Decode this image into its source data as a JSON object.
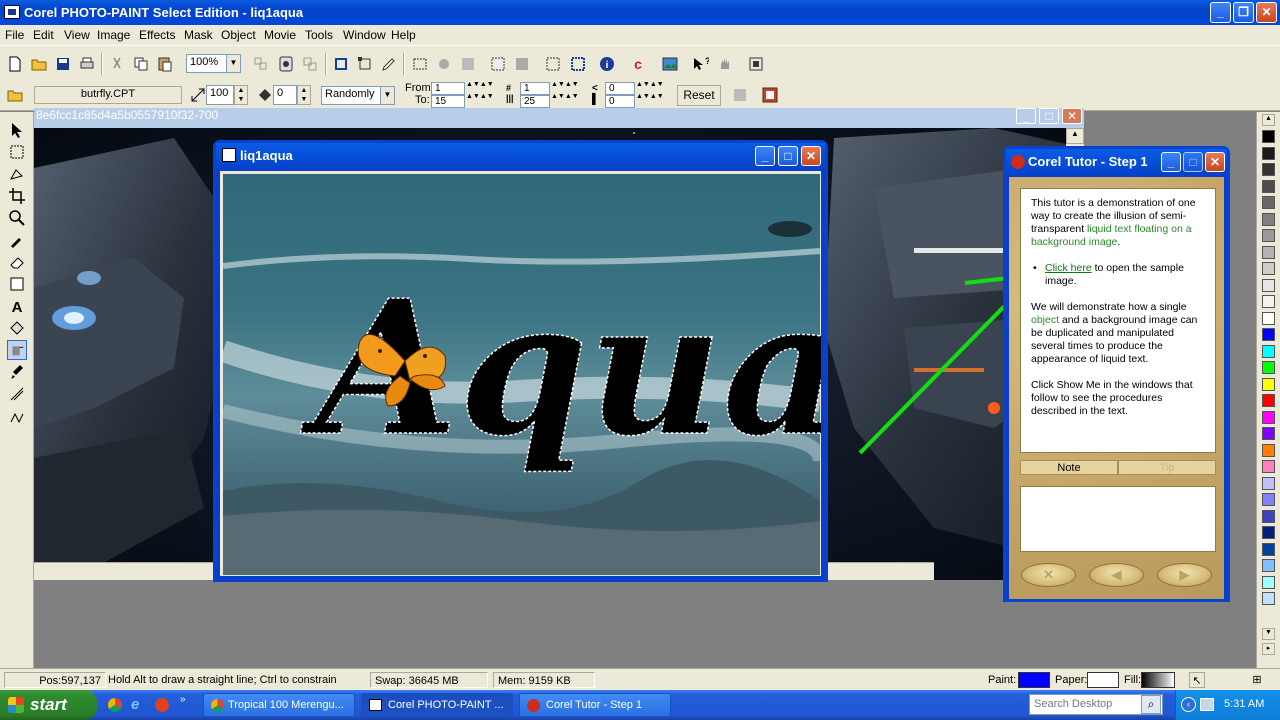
{
  "app": {
    "title": "Corel PHOTO-PAINT Select Edition - liq1aqua"
  },
  "menu": [
    "File",
    "Edit",
    "View",
    "Image",
    "Effects",
    "Mask",
    "Object",
    "Movie",
    "Tools",
    "Window",
    "Help"
  ],
  "toolbar": {
    "zoom": "100%"
  },
  "property_bar": {
    "brush_file": "butrfly.CPT",
    "size": "100",
    "rotate": "0",
    "mode": "Randomly",
    "from_label": "From:",
    "from_value": "1",
    "to_label": "To:",
    "to_value": "15",
    "field_a": "1",
    "field_b": "25",
    "field_c": "0",
    "field_d": "0",
    "reset_label": "Reset"
  },
  "background_doc": {
    "title": "8e6fcc1c85d4a5b0557910f32-700"
  },
  "image_window": {
    "title": "liq1aqua",
    "overlay_text": "Aqua"
  },
  "tutor": {
    "title": "Corel Tutor - Step 1",
    "intro": "This tutor is a demonstration of one way to create the illusion of semi-transparent ",
    "intro_green": "liquid text floating on a background image",
    "intro_end": ".",
    "bullet_link": "Click here",
    "bullet_rest": " to open the sample image.",
    "para2_a": "We will demonstrate how a single ",
    "para2_green": "object",
    "para2_b": " and a background image can be duplicated and manipulated several times to produce the appearance of liquid text.",
    "para3": "Click Show Me in the windows that follow to see the procedures described in the text.",
    "tab_note": "Note",
    "tab_tip": "Tip",
    "nav_icons": [
      "close-nav-icon",
      "back-nav-icon",
      "next-nav-icon"
    ]
  },
  "status": {
    "pos": "Pos:597,137",
    "hint": "Hold Alt to draw a straight line; Ctrl to constrain",
    "swap": "Swap: 36645 MB",
    "mem": "Mem: 9159 KB",
    "paint_label": "Paint:",
    "paper_label": "Paper:",
    "fill_label": "Fill:",
    "paint_color": "#0000ff",
    "paper_color": "#ffffff"
  },
  "taskbar": {
    "start": "start",
    "items": [
      "Tropical 100 Merengu...",
      "Corel PHOTO-PAINT ...",
      "Corel Tutor - Step 1"
    ],
    "search_placeholder": "Search Desktop",
    "clock": "5:31 AM"
  },
  "palette_colors": [
    "#000000",
    "#1a1a1a",
    "#333333",
    "#4d4d4d",
    "#666666",
    "#808080",
    "#999999",
    "#b3b3b3",
    "#cccccc",
    "#e6e6e6",
    "#f2f2f2",
    "#ffffff",
    "#0000ff",
    "#00ffff",
    "#00ff00",
    "#ffff00",
    "#ff0000",
    "#ff00ff",
    "#8000ff",
    "#ff8000",
    "#ff80c0",
    "#c0c0ff",
    "#8080ff",
    "#4040c0",
    "#002080",
    "#0040a0",
    "#80c0ff",
    "#a0ffff",
    "#c0e0ff"
  ]
}
